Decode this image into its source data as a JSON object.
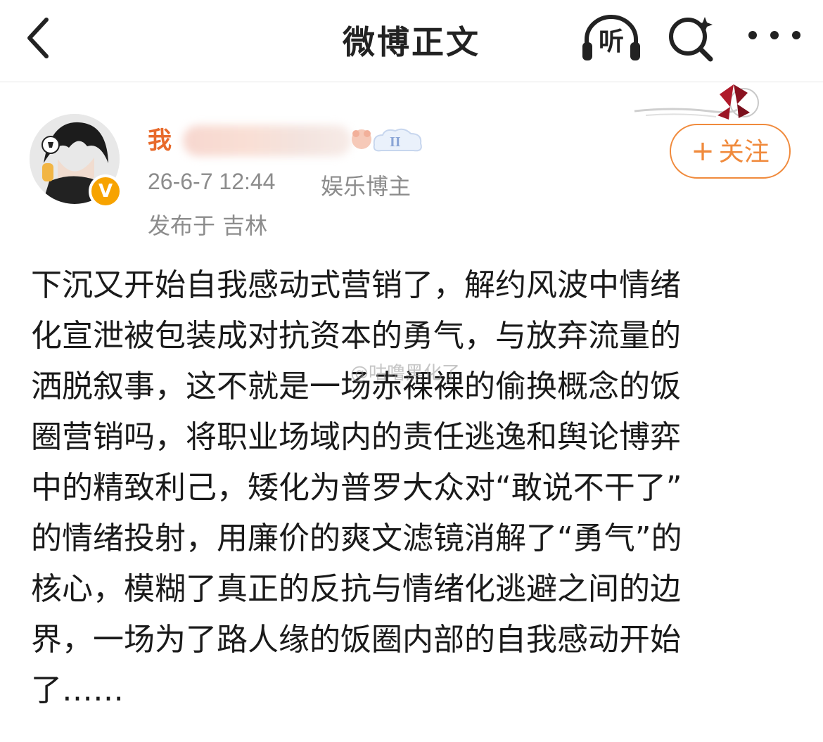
{
  "header": {
    "title": "微博正文",
    "listen_label": "听",
    "icons": [
      "back-chevron-icon",
      "listen-headphone-icon",
      "search-icon",
      "more-dots-icon"
    ]
  },
  "post": {
    "author": {
      "name_visible": "我",
      "avatar": "anime-avatar",
      "verified_badge": "V",
      "level_badge": "II"
    },
    "timestamp": "26-6-7 12:44",
    "role": "娱乐博主",
    "location": "发布于 吉林",
    "follow_label": "关注",
    "follow_plus": "+",
    "text_lines": [
      "下沉又开始自我感动式营销了，解约风波中情绪",
      "化宣泄被包装成对抗资本的勇气，与放弃流量的",
      "洒脱叙事，这不就是一场赤裸裸的偷换概念的饭",
      "圈营销吗，将职业场域内的责任逃逸和舆论博弈",
      "中的精致利己，矮化为普罗大众对“敢说不干了”",
      "的情绪投射，用廉价的爽文滤镜消解了“勇气”的",
      "核心，模糊了真正的反抗与情绪化逃避之间的边",
      "界，一场为了路人缘的饭圈内部的自我感动开始",
      "了……"
    ],
    "watermark": "@咕噜黑化了"
  },
  "colors": {
    "accent_orange": "#f08a3c",
    "username_orange": "#e86a2b",
    "meta_gray": "#8c8c8c",
    "verified_gold": "#f7a300"
  }
}
